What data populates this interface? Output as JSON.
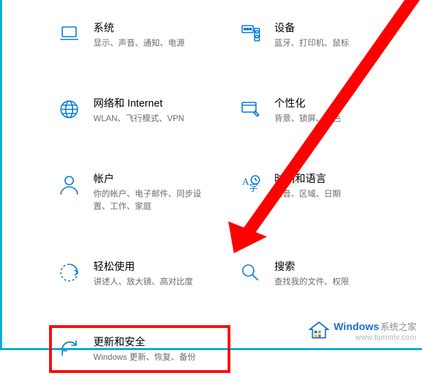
{
  "settings": {
    "items": [
      {
        "key": "system",
        "title": "系统",
        "desc": "显示、声音、通知、电源"
      },
      {
        "key": "devices",
        "title": "设备",
        "desc": "蓝牙、打印机、鼠标"
      },
      {
        "key": "network",
        "title": "网络和 Internet",
        "desc": "WLAN、飞行模式、VPN"
      },
      {
        "key": "personalize",
        "title": "个性化",
        "desc": "背景、锁屏、颜色"
      },
      {
        "key": "accounts",
        "title": "帐户",
        "desc": "你的帐户、电子邮件、同步设置、工作、家庭"
      },
      {
        "key": "time",
        "title": "时间和语言",
        "desc": "语音、区域、日期"
      },
      {
        "key": "ease",
        "title": "轻松使用",
        "desc": "讲述人、放大镜、高对比度"
      },
      {
        "key": "search",
        "title": "搜索",
        "desc": "查找我的文件、权限"
      },
      {
        "key": "update",
        "title": "更新和安全",
        "desc": "Windows 更新、恢复、备份"
      }
    ]
  },
  "watermark": {
    "brand": "Windows",
    "cn": "系统之家",
    "url": "www.bjmmlv.com"
  }
}
